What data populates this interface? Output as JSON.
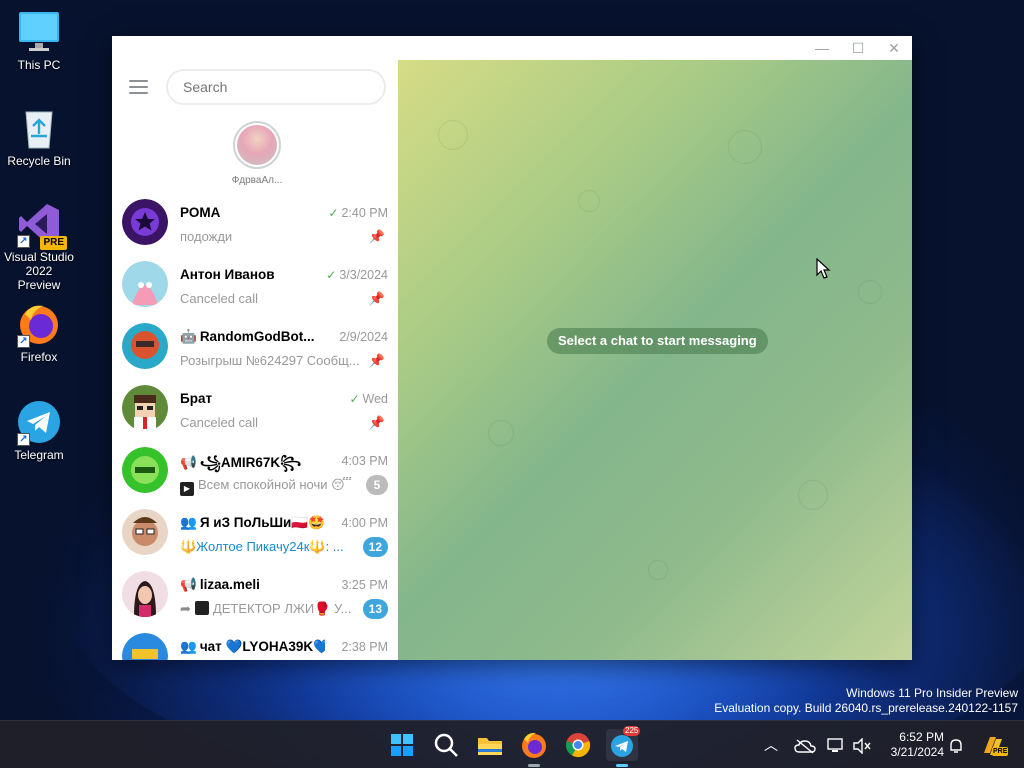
{
  "desktop": {
    "icons": [
      {
        "label": "This PC",
        "icon": "monitor-icon"
      },
      {
        "label": "Recycle Bin",
        "icon": "recycle-bin-icon"
      },
      {
        "label": "Visual Studio 2022 Preview",
        "icon": "visual-studio-icon",
        "badge": "PRE"
      },
      {
        "label": "Firefox",
        "icon": "firefox-icon"
      },
      {
        "label": "Telegram",
        "icon": "telegram-icon"
      }
    ]
  },
  "window": {
    "controls": {
      "minimize": "—",
      "maximize": "☐",
      "close": "✕"
    }
  },
  "sidebar": {
    "search_placeholder": "Search",
    "story": {
      "name": "ФдрваАл..."
    }
  },
  "chats": [
    {
      "name": "РОМА",
      "prefix": "",
      "time": "2:40 PM",
      "checked": "✓",
      "preview": "подожди",
      "pinned": "📌",
      "badge": "",
      "avatar_color": "#4a1a7a"
    },
    {
      "name": "Антон Иванов",
      "prefix": "",
      "time": "3/3/2024",
      "checked": "✓",
      "preview": "Canceled call",
      "pinned": "📌",
      "badge": "",
      "avatar_color": "#f4a7b9"
    },
    {
      "name": "RandomGodBot...",
      "prefix": "🤖",
      "time": "2/9/2024",
      "checked": "",
      "preview": "Розыгрыш №624297 Сообщ...",
      "pinned": "📌",
      "badge": "",
      "avatar_color": "#d9542e"
    },
    {
      "name": "Брат",
      "prefix": "",
      "time": "Wed",
      "checked": "✓",
      "preview": "Canceled call",
      "pinned": "📌",
      "badge": "",
      "avatar_color": "#5f7a3a"
    },
    {
      "name": "꧁AMIR67K꧂",
      "prefix": "📢",
      "time": "4:03 PM",
      "checked": "",
      "preview": "Всем спокойной ночи 😴",
      "pinned": "",
      "badge": "5",
      "badge_muted": true,
      "avatar_color": "#36b82a"
    },
    {
      "name": "Я иЗ ПоЛьШи🇵🇱🤩",
      "prefix": "👥",
      "time": "4:00 PM",
      "checked": "",
      "preview": "🔱Жолтое Пикачу24к🔱: ...",
      "pinned": "",
      "badge": "12",
      "badge_muted": false,
      "avatar_color": "#c98b6a"
    },
    {
      "name": "lizaa.meli",
      "prefix": "📢",
      "time": "3:25 PM",
      "checked": "",
      "preview": "ДЕТЕКТОР ЛЖИ🥊 У...",
      "pinned": "",
      "badge": "13",
      "badge_muted": false,
      "avatar_color": "#3a2a2a"
    },
    {
      "name": "чат 💙LYOHA39K💙",
      "prefix": "👥",
      "time": "2:38 PM",
      "checked": "",
      "preview": "",
      "pinned": "",
      "badge": "",
      "avatar_color": "#2a7ad6"
    }
  ],
  "chat_area": {
    "hint": "Select a chat to start messaging"
  },
  "watermark": {
    "line1": "Windows 11 Pro Insider Preview",
    "line2": "Evaluation copy. Build 26040.rs_prerelease.240122-1157"
  },
  "taskbar": {
    "telegram_badge": "225",
    "clock_time": "6:52 PM",
    "clock_date": "3/21/2024",
    "tray_badge": "PRE"
  }
}
